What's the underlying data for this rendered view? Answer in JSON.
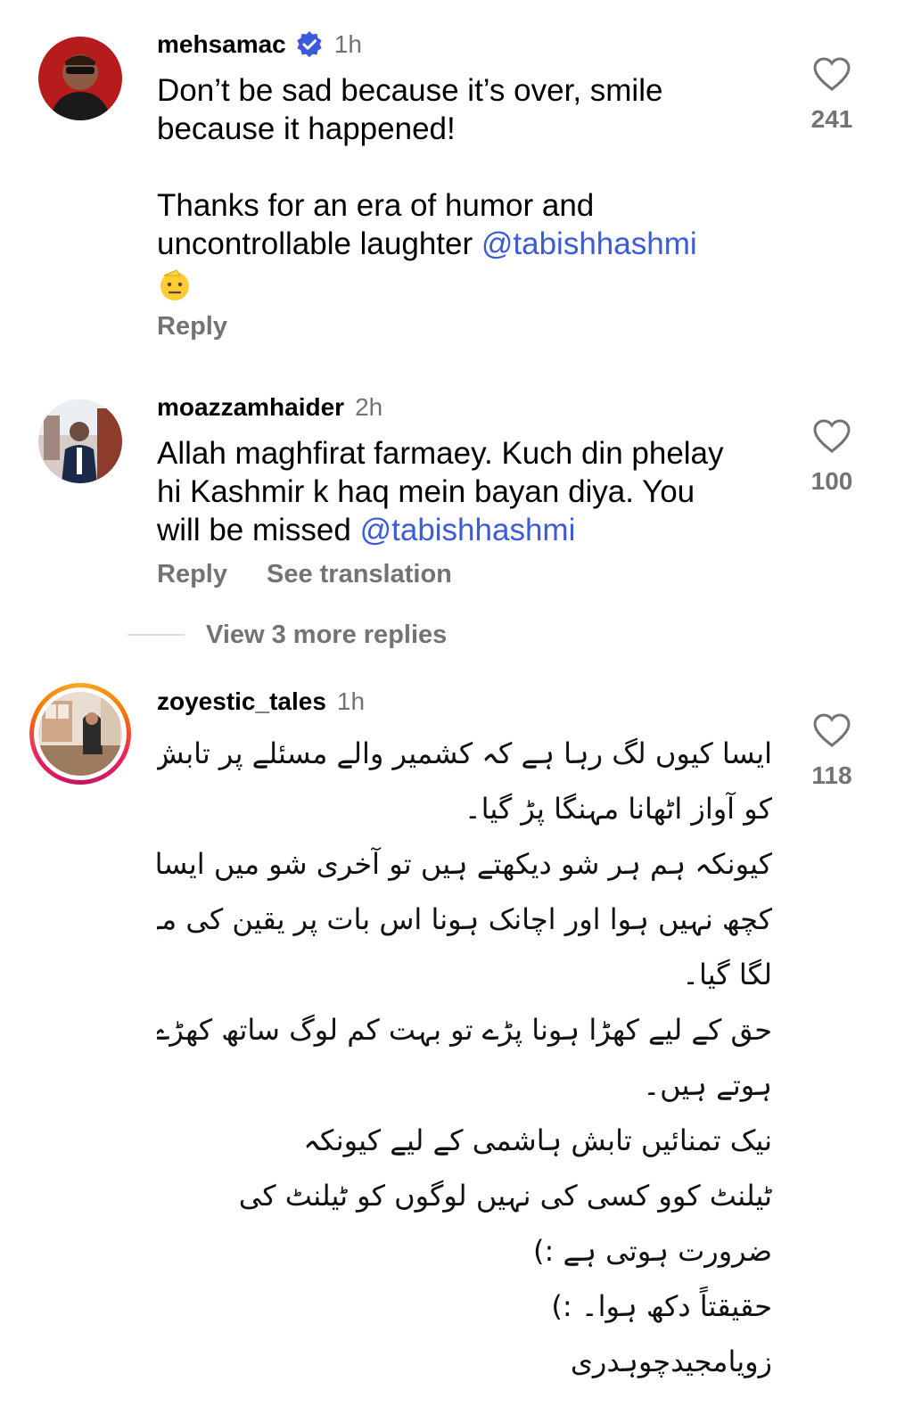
{
  "comments": [
    {
      "username": "mehsamac",
      "verified": true,
      "time": "1h",
      "text_line1": "Don’t be sad because it’s over, smile",
      "text_line2": "because it happened!",
      "text_line3": "Thanks for an era of humor and",
      "text_line4": "uncontrollable laughter",
      "mention": "@tabishhashmi",
      "emoji": "saluting-face",
      "reply_label": "Reply",
      "likes": "241"
    },
    {
      "username": "moazzamhaider",
      "time": "2h",
      "text_line1": "Allah maghfirat farmaey. Kuch din phelay",
      "text_line2": "hi Kashmir k haq mein bayan diya. You",
      "text_line3": "will be missed",
      "mention": "@tabishhashmi",
      "reply_label": "Reply",
      "translate_label": "See translation",
      "likes": "100",
      "view_more_label": "View 3 more replies"
    },
    {
      "username": "zoyestic_tales",
      "time": "1h",
      "has_story_ring": true,
      "likes": "118",
      "urdu_lines": [
        "ایسا کیوں لگ رہا ہے کہ کشمیر والے مسئلے پر تابش",
        "کو آواز اٹھانا مہنگا پڑ گیا۔",
        "کیونکہ ہم ہر شو دیکھتے ہیں تو آخری شو میں ایسا",
        "کچھ نہیں ہوا اور اچانک ہونا اس بات پر یقین کی مہر",
        "لگا گیا۔",
        "حق کے لیے کھڑا ہونا پڑے تو بہت کم لوگ ساتھ کھڑے",
        "ہوتے ہیں۔",
        "نیک تمنائیں تابش ہاشمی کے لیے کیونکہ",
        "ٹیلنٹ کوو کسی کی نہیں لوگوں کو ٹیلنٹ کی",
        "ضرورت ہوتی ہے :)",
        "حقیقتاً دکھ ہوا۔ :)",
        "زویامجیدچوہدری"
      ]
    }
  ],
  "colors": {
    "mention": "#3b5bdb",
    "secondary_text": "#737373",
    "verified_badge": "#3b5bdb"
  }
}
